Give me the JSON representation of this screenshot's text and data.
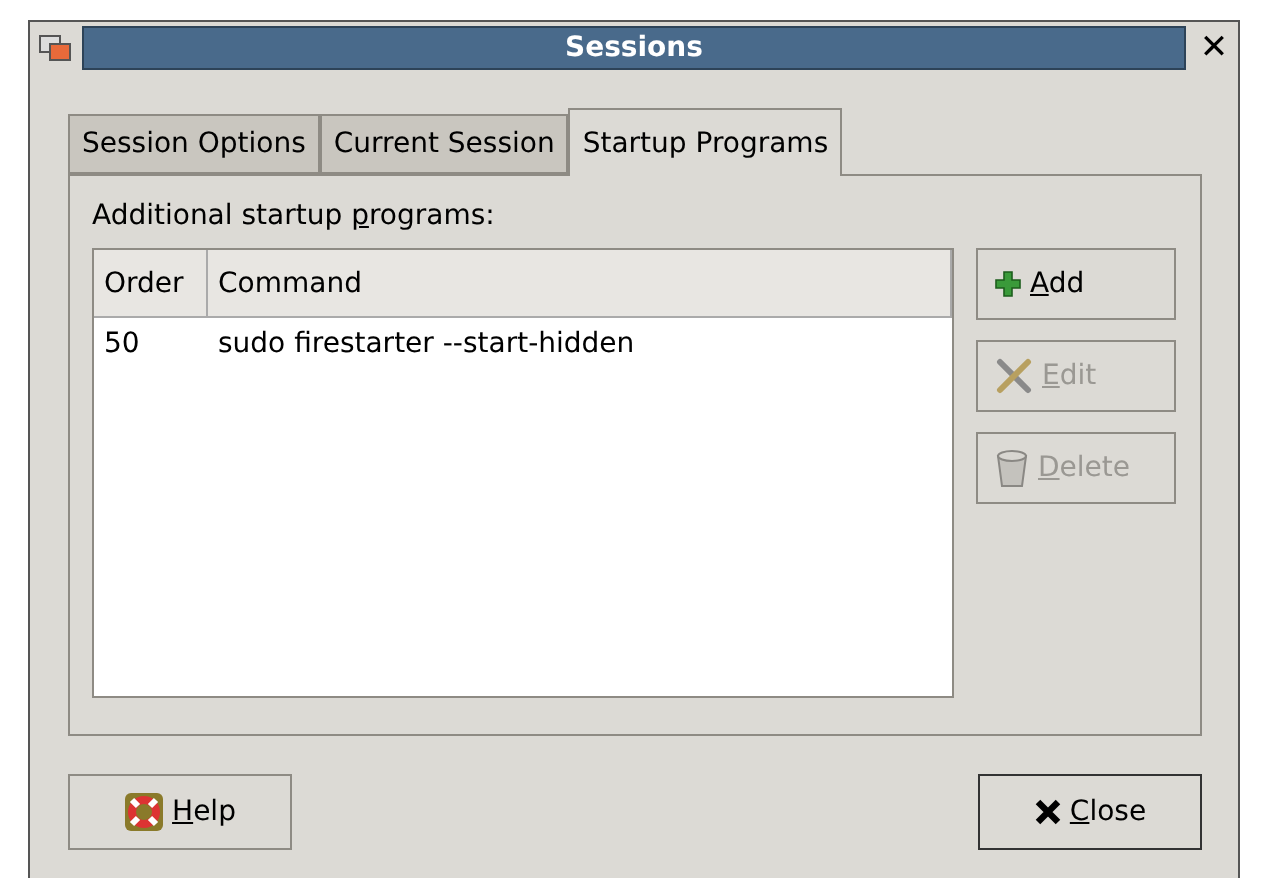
{
  "window": {
    "title": "Sessions",
    "close": "✕"
  },
  "tabs": [
    {
      "label": "Session Options",
      "selected": false
    },
    {
      "label": "Current Session",
      "selected": false
    },
    {
      "label": "Startup Programs",
      "selected": true
    }
  ],
  "section_label": {
    "pre": "Additional startup ",
    "key": "p",
    "post": "rograms:"
  },
  "table": {
    "columns": [
      "Order",
      "Command"
    ],
    "rows": [
      {
        "order": "50",
        "command": "sudo firestarter --start-hidden"
      }
    ]
  },
  "side_buttons": [
    {
      "kind": "add",
      "key": "A",
      "post": "dd",
      "disabled": false
    },
    {
      "kind": "edit",
      "key": "E",
      "post": "dit",
      "disabled": true
    },
    {
      "kind": "delete",
      "key": "D",
      "post": "elete",
      "disabled": true
    }
  ],
  "footer_buttons": [
    {
      "kind": "help",
      "key": "H",
      "post": "elp"
    },
    {
      "kind": "close",
      "key": "C",
      "post": "lose"
    }
  ]
}
